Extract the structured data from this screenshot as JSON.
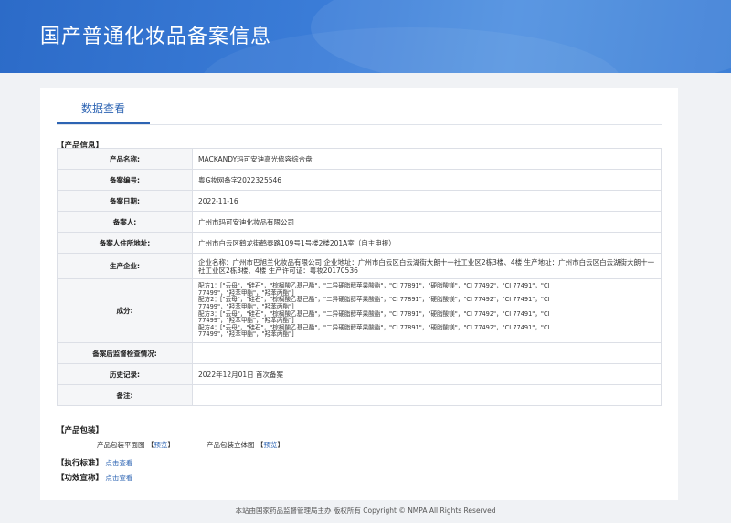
{
  "header": {
    "title": "国产普通化妆品备案信息"
  },
  "tabs": [
    {
      "label": "数据查看"
    }
  ],
  "sections": {
    "product_info": "【产品信息】",
    "packaging": "【产品包装】",
    "standard": "【执行标准】",
    "efficacy": "【功效宣称】"
  },
  "rows": [
    {
      "label": "产品名称:",
      "value": "MACKANDY玛可安迪高光修容综合盘"
    },
    {
      "label": "备案编号:",
      "value": "粤G妆网备字2022325546"
    },
    {
      "label": "备案日期:",
      "value": "2022-11-16"
    },
    {
      "label": "备案人:",
      "value": "广州市玛可安迪化妆品有限公司"
    },
    {
      "label": "备案人住所地址:",
      "value": "广州市白云区鹤龙街鹤泰路109号1号楼2楼201A室（自主申报）"
    },
    {
      "label": "生产企业:",
      "value": "企业名称：广州市巴旭兰化妆品有限公司 企业地址：广州市白云区白云湖街大朗十一社工业区2栋3楼、4楼 生产地址：广州市白云区白云湖街大朗十一社工业区2栋3楼、4楼 生产许可证：粤妆20170536"
    },
    {
      "label": "成分:",
      "value_lines": [
        "配方1：[\"云母\"，\"硅石\"，\"棕榈酸乙基己酯\"，\"二异硬脂醇苹果酸酯\"，\"CI 77891\"，\"硬脂酸镁\"，\"CI 77492\"，\"CI 77491\"，\"CI",
        "77499\"，\"羟苯甲酯\"，\"羟苯丙酯\"]",
        "配方2：[\"云母\"，\"硅石\"，\"棕榈酸乙基己酯\"，\"二异硬脂醇苹果酸酯\"，\"CI 77891\"，\"硬脂酸镁\"，\"CI 77492\"，\"CI 77491\"，\"CI",
        "77499\"，\"羟苯甲酯\"，\"羟苯丙酯\"]",
        "配方3：[\"云母\"，\"硅石\"，\"棕榈酸乙基己酯\"，\"二异硬脂醇苹果酸酯\"，\"CI 77891\"，\"硬脂酸镁\"，\"CI 77492\"，\"CI 77491\"，\"CI",
        "77499\"，\"羟苯甲酯\"，\"羟苯丙酯\"]",
        "配方4：[\"云母\"，\"硅石\"，\"棕榈酸乙基己酯\"，\"二异硬脂醇苹果酸酯\"，\"CI 77891\"，\"硬脂酸镁\"，\"CI 77492\"，\"CI 77491\"，\"CI",
        "77499\"，\"羟苯甲酯\"，\"羟苯丙酯\"]"
      ]
    },
    {
      "label": "备案后监督检查情况:",
      "value": ""
    },
    {
      "label": "历史记录:",
      "value": "2022年12月01日 首次备案"
    },
    {
      "label": "备注:",
      "value": ""
    }
  ],
  "packaging": {
    "flat_label": "产品包装平面图",
    "stereo_label": "产品包装立体图",
    "preview_open": "【",
    "preview_link": "预览",
    "preview_close": "】"
  },
  "links": {
    "view": "点击查看"
  },
  "footer": {
    "text": "本站由国家药品监督管理局主办 版权所有 Copyright © NMPA All Rights Reserved"
  }
}
